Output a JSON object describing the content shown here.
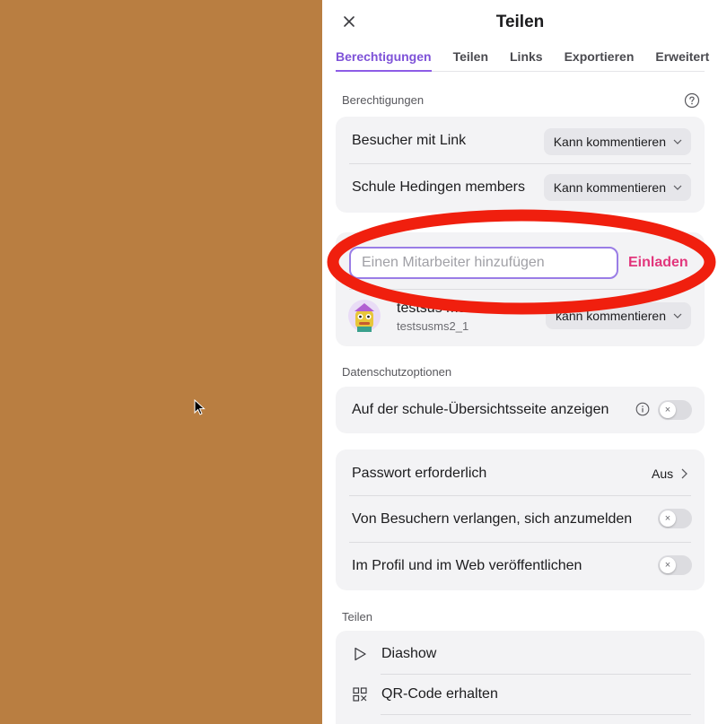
{
  "panel": {
    "title": "Teilen",
    "tabs": [
      {
        "label": "Berechtigungen",
        "active": true
      },
      {
        "label": "Teilen",
        "active": false
      },
      {
        "label": "Links",
        "active": false
      },
      {
        "label": "Exportieren",
        "active": false
      },
      {
        "label": "Erweitert",
        "active": false
      }
    ]
  },
  "permissions": {
    "section_label": "Berechtigungen",
    "rows": [
      {
        "label": "Besucher mit Link",
        "value": "Kann kommentieren"
      },
      {
        "label": "Schule Hedingen members",
        "value": "Kann kommentieren"
      }
    ]
  },
  "invite": {
    "placeholder": "Einen Mitarbeiter hinzufügen",
    "button_label": "Einladen",
    "member_name": "testsus ms2",
    "member_username": "testsusms2_1",
    "member_role": "Kann kommentieren",
    "member_role_visible": "kann kommentieren"
  },
  "privacy": {
    "section_label": "Datenschutzoptionen",
    "overview_label": "Auf der schule-Übersichtsseite anzeigen",
    "overview_enabled": false
  },
  "security": {
    "password_label": "Passwort erforderlich",
    "password_value": "Aus",
    "signin_label": "Von Besuchern verlangen, sich anzumelden",
    "signin_enabled": false,
    "publish_label": "Im Profil und im Web veröffentlichen",
    "publish_enabled": false
  },
  "share": {
    "section_label": "Teilen",
    "items": [
      {
        "label": "Diashow",
        "icon": "play-icon"
      },
      {
        "label": "QR-Code erhalten",
        "icon": "qr-code-icon"
      }
    ]
  },
  "colors": {
    "background": "#b97e41",
    "accent": "#8d5ce6",
    "invite": "#e2367c",
    "annotation": "#f01f0e"
  }
}
